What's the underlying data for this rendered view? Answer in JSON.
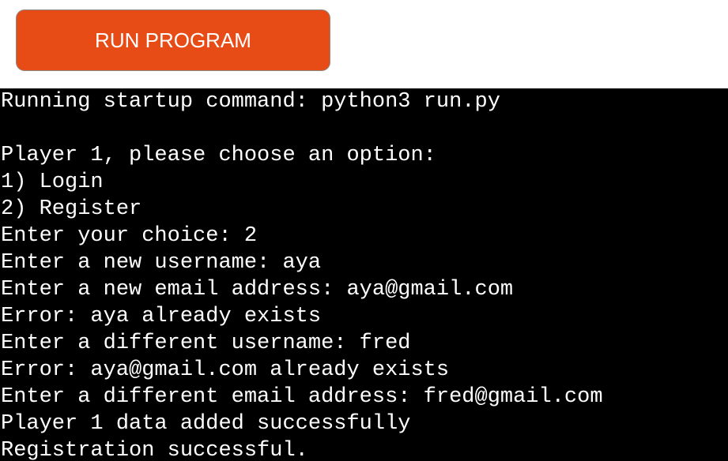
{
  "toolbar": {
    "run_button_label": "RUN PROGRAM",
    "run_button_color": "#e84c16"
  },
  "terminal": {
    "background": "#000000",
    "text_color": "#ffffff",
    "lines": [
      "Running startup command: python3 run.py",
      "",
      "Player 1, please choose an option:",
      "1) Login",
      "2) Register",
      "Enter your choice: 2",
      "Enter a new username: aya",
      "Enter a new email address: aya@gmail.com",
      "Error: aya already exists",
      "Enter a different username: fred",
      "Error: aya@gmail.com already exists",
      "Enter a different email address: fred@gmail.com",
      "Player 1 data added successfully",
      "Registration successful."
    ]
  }
}
